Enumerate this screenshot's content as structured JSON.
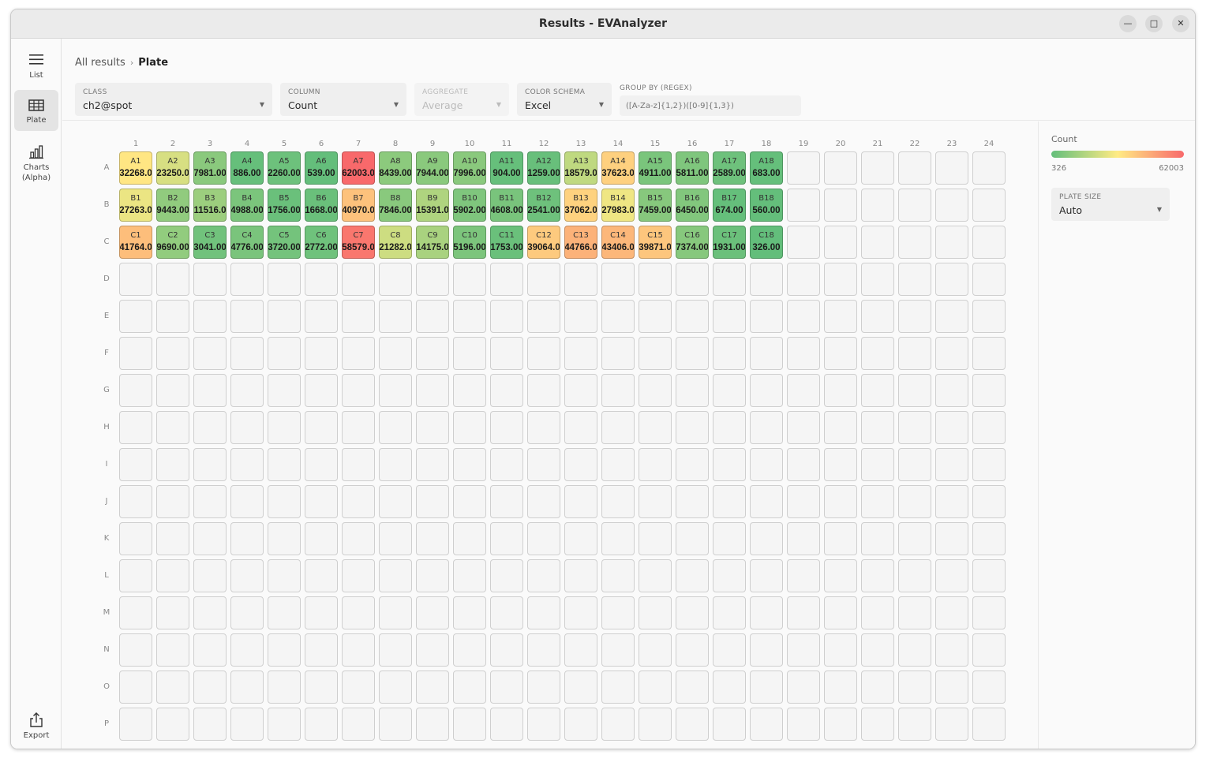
{
  "window": {
    "title": "Results - EVAnalyzer"
  },
  "sidebar": {
    "items": [
      {
        "label": "List",
        "icon": "hamburger-icon"
      },
      {
        "label": "Plate",
        "icon": "grid-icon",
        "active": true
      },
      {
        "label": "Charts (Alpha)",
        "icon": "bar-chart-icon"
      }
    ],
    "export_label": "Export"
  },
  "breadcrumb": {
    "root": "All results",
    "sep": "›",
    "current": "Plate"
  },
  "filters": {
    "class": {
      "caption": "CLASS",
      "value": "ch2@spot"
    },
    "column": {
      "caption": "COLUMN",
      "value": "Count"
    },
    "aggregate": {
      "caption": "AGGREGATE",
      "value": "Average",
      "disabled": true
    },
    "color_schema": {
      "caption": "COLOR SCHEMA",
      "value": "Excel"
    },
    "group_by": {
      "caption": "GROUP BY (REGEX)",
      "placeholder": "([A-Za-z]{1,2})([0-9]{1,3})"
    }
  },
  "legend": {
    "title": "Count",
    "min": "326",
    "max": "62003",
    "min_value": 326,
    "max_value": 62003,
    "colors": [
      "#63be7b",
      "#ffeb84",
      "#f8696b"
    ]
  },
  "plate_size": {
    "caption": "PLATE SIZE",
    "value": "Auto"
  },
  "plate": {
    "columns": [
      "1",
      "2",
      "3",
      "4",
      "5",
      "6",
      "7",
      "8",
      "9",
      "10",
      "11",
      "12",
      "13",
      "14",
      "15",
      "16",
      "17",
      "18",
      "19",
      "20",
      "21",
      "22",
      "23",
      "24"
    ],
    "rows": [
      "A",
      "B",
      "C",
      "D",
      "E",
      "F",
      "G",
      "H",
      "I",
      "J",
      "K",
      "L",
      "M",
      "N",
      "O",
      "P"
    ],
    "wells": [
      {
        "row": "A",
        "col": 1,
        "name": "A1",
        "value": 32268,
        "label": "32268.0"
      },
      {
        "row": "A",
        "col": 2,
        "name": "A2",
        "value": 23250,
        "label": "23250.0"
      },
      {
        "row": "A",
        "col": 3,
        "name": "A3",
        "value": 7981,
        "label": "7981.00"
      },
      {
        "row": "A",
        "col": 4,
        "name": "A4",
        "value": 886,
        "label": "886.00"
      },
      {
        "row": "A",
        "col": 5,
        "name": "A5",
        "value": 2260,
        "label": "2260.00"
      },
      {
        "row": "A",
        "col": 6,
        "name": "A6",
        "value": 539,
        "label": "539.00"
      },
      {
        "row": "A",
        "col": 7,
        "name": "A7",
        "value": 62003,
        "label": "62003.0"
      },
      {
        "row": "A",
        "col": 8,
        "name": "A8",
        "value": 8439,
        "label": "8439.00"
      },
      {
        "row": "A",
        "col": 9,
        "name": "A9",
        "value": 7944,
        "label": "7944.00"
      },
      {
        "row": "A",
        "col": 10,
        "name": "A10",
        "value": 7996,
        "label": "7996.00"
      },
      {
        "row": "A",
        "col": 11,
        "name": "A11",
        "value": 904,
        "label": "904.00"
      },
      {
        "row": "A",
        "col": 12,
        "name": "A12",
        "value": 1259,
        "label": "1259.00"
      },
      {
        "row": "A",
        "col": 13,
        "name": "A13",
        "value": 18579,
        "label": "18579.0"
      },
      {
        "row": "A",
        "col": 14,
        "name": "A14",
        "value": 37623,
        "label": "37623.0"
      },
      {
        "row": "A",
        "col": 15,
        "name": "A15",
        "value": 4911,
        "label": "4911.00"
      },
      {
        "row": "A",
        "col": 16,
        "name": "A16",
        "value": 5811,
        "label": "5811.00"
      },
      {
        "row": "A",
        "col": 17,
        "name": "A17",
        "value": 2589,
        "label": "2589.00"
      },
      {
        "row": "A",
        "col": 18,
        "name": "A18",
        "value": 683,
        "label": "683.00"
      },
      {
        "row": "B",
        "col": 1,
        "name": "B1",
        "value": 27263,
        "label": "27263.0"
      },
      {
        "row": "B",
        "col": 2,
        "name": "B2",
        "value": 9443,
        "label": "9443.00"
      },
      {
        "row": "B",
        "col": 3,
        "name": "B3",
        "value": 11516,
        "label": "11516.0"
      },
      {
        "row": "B",
        "col": 4,
        "name": "B4",
        "value": 4988,
        "label": "4988.00"
      },
      {
        "row": "B",
        "col": 5,
        "name": "B5",
        "value": 1756,
        "label": "1756.00"
      },
      {
        "row": "B",
        "col": 6,
        "name": "B6",
        "value": 1668,
        "label": "1668.00"
      },
      {
        "row": "B",
        "col": 7,
        "name": "B7",
        "value": 40970,
        "label": "40970.0"
      },
      {
        "row": "B",
        "col": 8,
        "name": "B8",
        "value": 7846,
        "label": "7846.00"
      },
      {
        "row": "B",
        "col": 9,
        "name": "B9",
        "value": 15391,
        "label": "15391.0"
      },
      {
        "row": "B",
        "col": 10,
        "name": "B10",
        "value": 5902,
        "label": "5902.00"
      },
      {
        "row": "B",
        "col": 11,
        "name": "B11",
        "value": 4608,
        "label": "4608.00"
      },
      {
        "row": "B",
        "col": 12,
        "name": "B12",
        "value": 2541,
        "label": "2541.00"
      },
      {
        "row": "B",
        "col": 13,
        "name": "B13",
        "value": 37062,
        "label": "37062.0"
      },
      {
        "row": "B",
        "col": 14,
        "name": "B14",
        "value": 27983,
        "label": "27983.0"
      },
      {
        "row": "B",
        "col": 15,
        "name": "B15",
        "value": 7459,
        "label": "7459.00"
      },
      {
        "row": "B",
        "col": 16,
        "name": "B16",
        "value": 6450,
        "label": "6450.00"
      },
      {
        "row": "B",
        "col": 17,
        "name": "B17",
        "value": 674,
        "label": "674.00"
      },
      {
        "row": "B",
        "col": 18,
        "name": "B18",
        "value": 560,
        "label": "560.00"
      },
      {
        "row": "C",
        "col": 1,
        "name": "C1",
        "value": 41764,
        "label": "41764.0"
      },
      {
        "row": "C",
        "col": 2,
        "name": "C2",
        "value": 9690,
        "label": "9690.00"
      },
      {
        "row": "C",
        "col": 3,
        "name": "C3",
        "value": 3041,
        "label": "3041.00"
      },
      {
        "row": "C",
        "col": 4,
        "name": "C4",
        "value": 4776,
        "label": "4776.00"
      },
      {
        "row": "C",
        "col": 5,
        "name": "C5",
        "value": 3720,
        "label": "3720.00"
      },
      {
        "row": "C",
        "col": 6,
        "name": "C6",
        "value": 2772,
        "label": "2772.00"
      },
      {
        "row": "C",
        "col": 7,
        "name": "C7",
        "value": 58579,
        "label": "58579.0"
      },
      {
        "row": "C",
        "col": 8,
        "name": "C8",
        "value": 21282,
        "label": "21282.0"
      },
      {
        "row": "C",
        "col": 9,
        "name": "C9",
        "value": 14175,
        "label": "14175.0"
      },
      {
        "row": "C",
        "col": 10,
        "name": "C10",
        "value": 5196,
        "label": "5196.00"
      },
      {
        "row": "C",
        "col": 11,
        "name": "C11",
        "value": 1753,
        "label": "1753.00"
      },
      {
        "row": "C",
        "col": 12,
        "name": "C12",
        "value": 39064,
        "label": "39064.0"
      },
      {
        "row": "C",
        "col": 13,
        "name": "C13",
        "value": 44766,
        "label": "44766.0"
      },
      {
        "row": "C",
        "col": 14,
        "name": "C14",
        "value": 43406,
        "label": "43406.0"
      },
      {
        "row": "C",
        "col": 15,
        "name": "C15",
        "value": 39871,
        "label": "39871.0"
      },
      {
        "row": "C",
        "col": 16,
        "name": "C16",
        "value": 7374,
        "label": "7374.00"
      },
      {
        "row": "C",
        "col": 17,
        "name": "C17",
        "value": 1931,
        "label": "1931.00"
      },
      {
        "row": "C",
        "col": 18,
        "name": "C18",
        "value": 326,
        "label": "326.00"
      }
    ]
  }
}
